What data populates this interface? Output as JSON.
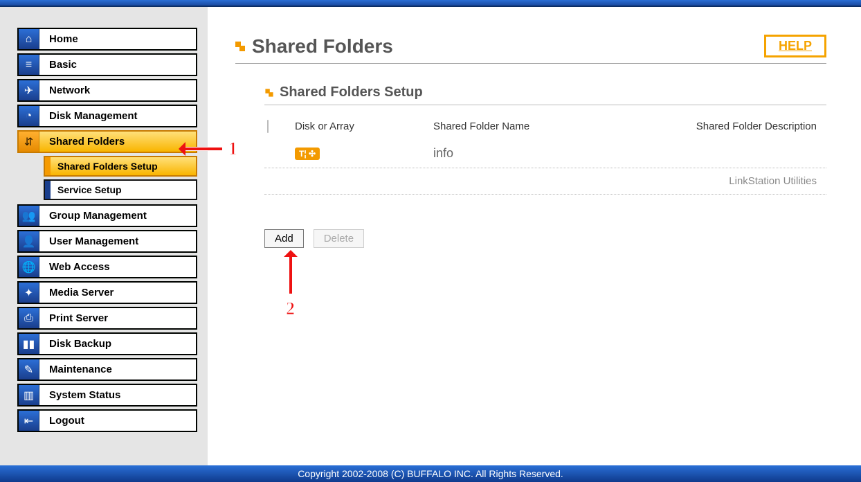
{
  "sidebar": {
    "items": [
      {
        "id": "home",
        "label": "Home",
        "icon": "⌂"
      },
      {
        "id": "basic",
        "label": "Basic",
        "icon": "≡"
      },
      {
        "id": "network",
        "label": "Network",
        "icon": "✈"
      },
      {
        "id": "disk-management",
        "label": "Disk Management",
        "icon": "◔"
      },
      {
        "id": "shared-folders",
        "label": "Shared Folders",
        "icon": "⇵",
        "active": true,
        "children": [
          {
            "id": "shared-folders-setup",
            "label": "Shared Folders Setup",
            "active": true
          },
          {
            "id": "service-setup",
            "label": "Service Setup"
          }
        ]
      },
      {
        "id": "group-management",
        "label": "Group Management",
        "icon": "👥"
      },
      {
        "id": "user-management",
        "label": "User Management",
        "icon": "👤"
      },
      {
        "id": "web-access",
        "label": "Web Access",
        "icon": "🌐"
      },
      {
        "id": "media-server",
        "label": "Media Server",
        "icon": "✦"
      },
      {
        "id": "print-server",
        "label": "Print Server",
        "icon": "⎙"
      },
      {
        "id": "disk-backup",
        "label": "Disk Backup",
        "icon": "▮▮"
      },
      {
        "id": "maintenance",
        "label": "Maintenance",
        "icon": "✎"
      },
      {
        "id": "system-status",
        "label": "System Status",
        "icon": "▥"
      },
      {
        "id": "logout",
        "label": "Logout",
        "icon": "⇤"
      }
    ]
  },
  "page": {
    "title": "Shared Folders",
    "help_label": "HELP"
  },
  "section": {
    "title": "Shared Folders Setup",
    "columns": {
      "disk": "Disk or Array",
      "name": "Shared Folder Name",
      "desc": "Shared Folder Description"
    },
    "rows": [
      {
        "name": "info",
        "desc": ""
      },
      {
        "name": "",
        "desc": "LinkStation Utilities"
      }
    ]
  },
  "actions": {
    "add": "Add",
    "delete": "Delete"
  },
  "footer": "Copyright 2002-2008 (C) BUFFALO INC. All Rights Reserved.",
  "annotations": {
    "one": "1",
    "two": "2"
  }
}
